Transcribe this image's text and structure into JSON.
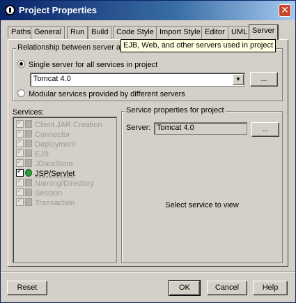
{
  "window": {
    "title": "Project Properties"
  },
  "tabs": [
    "Paths",
    "General",
    "Run",
    "Build",
    "Code Style",
    "Import Style",
    "Editor",
    "UML",
    "Server"
  ],
  "tooltip": "EJB, Web, and other servers used in project",
  "relationship": {
    "legend": "Relationship between server an",
    "single_label": "Single server for all services in project",
    "server_value": "Tomcat 4.0",
    "browse_label": "...",
    "modular_label": "Modular services provided by different servers"
  },
  "services": {
    "label": "Services:",
    "items": [
      {
        "label": "Client JAR Creation"
      },
      {
        "label": "Connector"
      },
      {
        "label": "Deployment"
      },
      {
        "label": "EJB"
      },
      {
        "label": "JDataStore"
      },
      {
        "label": "JSP/Servlet"
      },
      {
        "label": "Naming/Directory"
      },
      {
        "label": "Session"
      },
      {
        "label": "Transaction"
      }
    ]
  },
  "service_props": {
    "legend": "Service properties for project",
    "server_label": "Server:",
    "server_value": "Tomcat 4.0",
    "browse_label": "...",
    "hint": "Select service to view"
  },
  "buttons": {
    "reset": "Reset",
    "ok": "OK",
    "cancel": "Cancel",
    "help": "Help"
  }
}
